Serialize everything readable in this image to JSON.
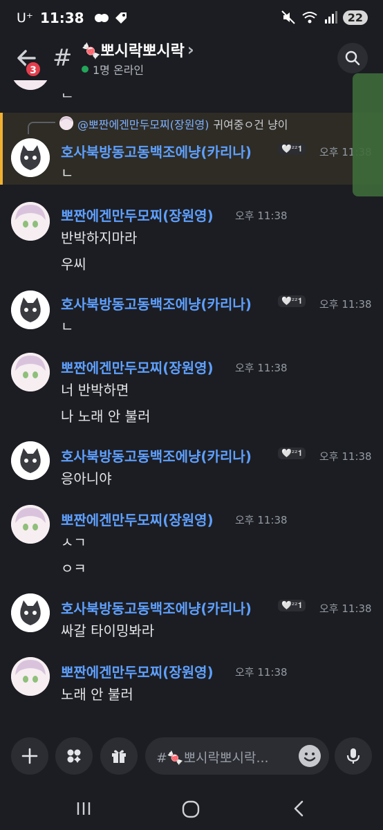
{
  "status_bar": {
    "carrier": "U⁺",
    "time": "11:38",
    "battery": "22"
  },
  "header": {
    "back_badge": "3",
    "hash": "#",
    "channel_name": "🍬뽀시락뽀시락",
    "chevron": "›",
    "online_text": "1명 온라인"
  },
  "partial_top_text": "ᆫ",
  "reply": {
    "mention_user": "@뽀짠에겐만두모찌(장원영)",
    "snippet": "귀여중ㅇ건 냥이"
  },
  "messages": [
    {
      "author": "호사북방동고동백조에냥(카리나)",
      "status": "🤍ᶻᶻ𝟏",
      "time": "오후 11:38",
      "lines": [
        "ㄴ"
      ]
    },
    {
      "author": "뽀짠에겐만두모찌(장원영)",
      "status": "",
      "time": "오후 11:38",
      "lines": [
        "반박하지마라",
        "우씨"
      ]
    },
    {
      "author": "호사북방동고동백조에냥(카리나)",
      "status": "🤍ᶻᶻ𝟏",
      "time": "오후 11:38",
      "lines": [
        "ㄴ"
      ]
    },
    {
      "author": "뽀짠에겐만두모찌(장원영)",
      "status": "",
      "time": "오후 11:38",
      "lines": [
        "너 반박하면",
        "나 노래 안 불러"
      ]
    },
    {
      "author": "호사북방동고동백조에냥(카리나)",
      "status": "🤍ᶻᶻ𝟏",
      "time": "오후 11:38",
      "lines": [
        "응아니야"
      ]
    },
    {
      "author": "뽀짠에겐만두모찌(장원영)",
      "status": "",
      "time": "오후 11:38",
      "lines": [
        "ㅅㄱ",
        "ㅇㅋ"
      ]
    },
    {
      "author": "호사북방동고동백조에냥(카리나)",
      "status": "🤍ᶻᶻ𝟏",
      "time": "오후 11:38",
      "lines": [
        "싸갈 타이밍봐라"
      ]
    },
    {
      "author": "뽀짠에겐만두모찌(장원영)",
      "status": "",
      "time": "오후 11:38",
      "lines": [
        "노래 안 불러"
      ]
    }
  ],
  "composer": {
    "placeholder": "#🍬뽀시락뽀시락..."
  },
  "icons": [
    "back-arrow-icon",
    "search-icon",
    "plus-icon",
    "apps-icon",
    "gift-icon",
    "emoji-icon",
    "mic-icon",
    "recents-icon",
    "home-icon",
    "back-nav-icon"
  ],
  "colors": {
    "accent_blue": "#5ea0ff",
    "reply_highlight": "#f0b132",
    "online": "#23a55a",
    "badge": "#e53e4d"
  }
}
